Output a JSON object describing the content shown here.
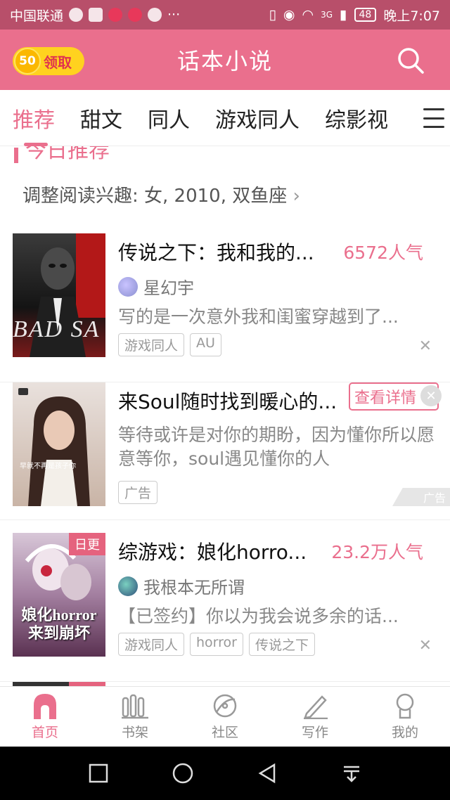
{
  "status_bar": {
    "carrier": "中国联通",
    "signal": "3G",
    "battery": "48",
    "time": "晚上7:07",
    "more": "···"
  },
  "header": {
    "coin_value": "50",
    "coin_label": "领取",
    "title": "话本小说"
  },
  "tabs": [
    "推荐",
    "甜文",
    "同人",
    "游戏同人",
    "综影视"
  ],
  "section": {
    "title": "今日推荐",
    "prefs": "调整阅读兴趣: 女, 2010, 双鱼座"
  },
  "items": [
    {
      "title": "传说之下：我和我的...",
      "popularity": "6572人气",
      "author": "星幻宇",
      "desc": "写的是一次意外我和闺蜜穿越到了...",
      "tags": [
        "游戏同人",
        "AU"
      ],
      "cover_text": "BAD SA"
    },
    {
      "title": "综游戏：娘化horro...",
      "popularity": "23.2万人气",
      "author": "我根本无所谓",
      "desc": "【已签约】你以为我会说多余的话...",
      "tags": [
        "游戏同人",
        "horror",
        "传说之下"
      ],
      "badge": "日更",
      "cover_text": "娘化horror来到崩坏"
    }
  ],
  "ad": {
    "title": "来Soul随时找到暖心的...",
    "button": "查看详情",
    "desc": "等待或许是对你的期盼，因为懂你所以愿意等你，soul遇见懂你的人",
    "tag": "广告",
    "badge": "广告",
    "cover_text": "早就不再是孩子你"
  },
  "bottom_nav": [
    "首页",
    "书架",
    "社区",
    "写作",
    "我的"
  ],
  "colors": {
    "brand": "#ea6f8d",
    "status_bar": "#b84f6a",
    "coin": "#ffd21f"
  }
}
